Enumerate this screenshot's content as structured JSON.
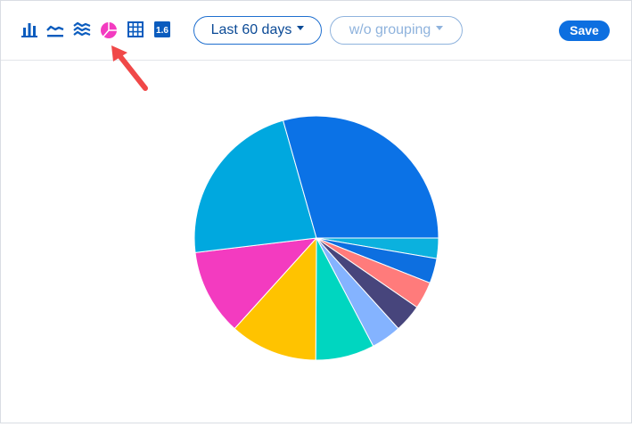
{
  "toolbar": {
    "icons": [
      "bar-chart-icon",
      "line-chart-icon",
      "area-chart-icon",
      "pie-chart-icon",
      "table-icon",
      "number-icon"
    ],
    "number_icon_text": "1.6",
    "date_range_label": "Last 60 days",
    "grouping_label": "w/o grouping",
    "save_label": "Save"
  },
  "colors": {
    "accent": "#0d6fe0",
    "active_icon": "#f33bc0",
    "inactive_icon": "#0b5cbe",
    "annotation_arrow": "#f04848"
  },
  "chart_data": {
    "type": "pie",
    "start_angle_deg": 0,
    "direction": "clockwise",
    "slices": [
      {
        "value": 2.7,
        "color": "#0bb1de"
      },
      {
        "value": 3.3,
        "color": "#0d6fe0"
      },
      {
        "value": 3.6,
        "color": "#ff7b7b"
      },
      {
        "value": 3.7,
        "color": "#47457c"
      },
      {
        "value": 4.0,
        "color": "#84b3ff"
      },
      {
        "value": 7.8,
        "color": "#00d6c0"
      },
      {
        "value": 11.6,
        "color": "#ffc300"
      },
      {
        "value": 11.4,
        "color": "#f33bc0"
      },
      {
        "value": 22.5,
        "color": "#00a8df"
      },
      {
        "value": 29.4,
        "color": "#0b72e6"
      }
    ]
  }
}
